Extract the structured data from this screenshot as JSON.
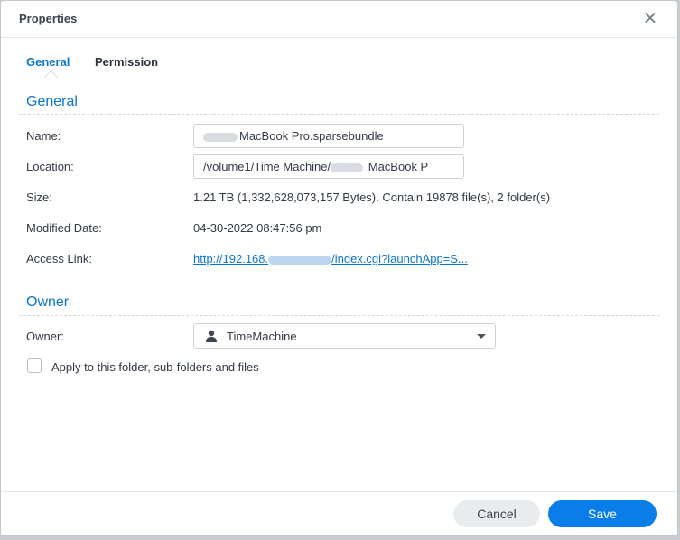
{
  "dialog": {
    "title": "Properties"
  },
  "tabs": [
    {
      "label": "General",
      "active": true
    },
    {
      "label": "Permission",
      "active": false
    }
  ],
  "general": {
    "section_title": "General",
    "name": {
      "label": "Name:",
      "value": "MacBook Pro.sparsebundle"
    },
    "location": {
      "label": "Location:",
      "value_prefix": "/volume1/Time Machine/",
      "value_suffix": " MacBook P"
    },
    "size": {
      "label": "Size:",
      "value": "1.21 TB (1,332,628,073,157 Bytes). Contain 19878 file(s), 2 folder(s)"
    },
    "modified": {
      "label": "Modified Date:",
      "value": "04-30-2022 08:47:56 pm"
    },
    "access_link": {
      "label": "Access Link:",
      "prefix": "http://192.168.",
      "suffix": "/index.cgi?launchApp=S..."
    }
  },
  "owner": {
    "section_title": "Owner",
    "label": "Owner:",
    "selected": "TimeMachine",
    "apply_checkbox": {
      "label": "Apply to this folder, sub-folders and files",
      "checked": false
    }
  },
  "footer": {
    "cancel_label": "Cancel",
    "save_label": "Save"
  },
  "colors": {
    "accent": "#0a75cc",
    "primary_button": "#0a7de8"
  }
}
